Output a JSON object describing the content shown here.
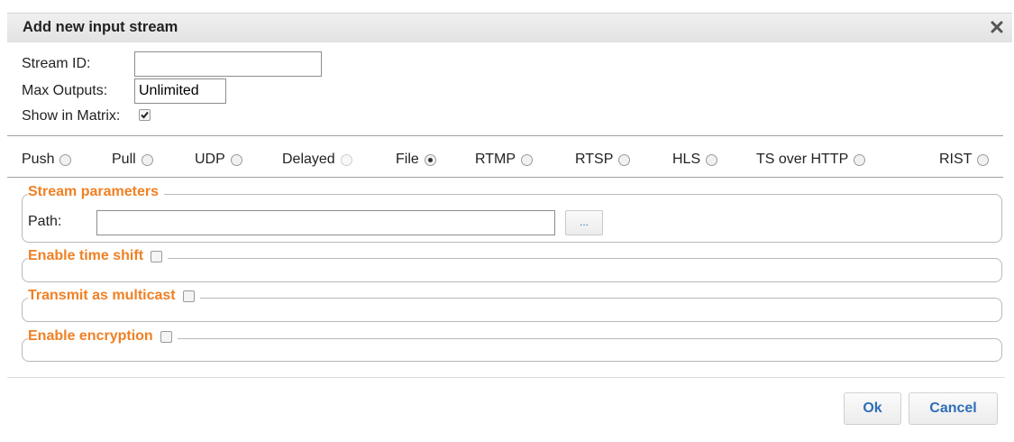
{
  "dialog": {
    "title": "Add new input stream",
    "close_icon": "close-icon"
  },
  "fields": {
    "stream_id_label": "Stream ID:",
    "stream_id_value": "",
    "max_outputs_label": "Max Outputs:",
    "max_outputs_value": "Unlimited",
    "show_in_matrix_label": "Show in Matrix:",
    "show_in_matrix_checked": true
  },
  "stream_types": [
    {
      "label": "Push",
      "checked": false,
      "disabled": false
    },
    {
      "label": "Pull",
      "checked": false,
      "disabled": false
    },
    {
      "label": "UDP",
      "checked": false,
      "disabled": false
    },
    {
      "label": "Delayed",
      "checked": false,
      "disabled": true
    },
    {
      "label": "File",
      "checked": true,
      "disabled": false
    },
    {
      "label": "RTMP",
      "checked": false,
      "disabled": false
    },
    {
      "label": "RTSP",
      "checked": false,
      "disabled": false
    },
    {
      "label": "HLS",
      "checked": false,
      "disabled": false
    },
    {
      "label": "TS over HTTP",
      "checked": false,
      "disabled": false
    },
    {
      "label": "RIST",
      "checked": false,
      "disabled": false
    }
  ],
  "stream_parameters": {
    "legend": "Stream parameters",
    "path_label": "Path:",
    "path_value": "",
    "browse_label": "..."
  },
  "sections": {
    "time_shift": {
      "legend": "Enable time shift",
      "checked": false
    },
    "multicast": {
      "legend": "Transmit as multicast",
      "checked": false
    },
    "encryption": {
      "legend": "Enable encryption",
      "checked": false
    }
  },
  "buttons": {
    "ok": "Ok",
    "cancel": "Cancel"
  },
  "colors": {
    "legend_orange": "#f08024",
    "button_blue": "#2f6fb8"
  }
}
